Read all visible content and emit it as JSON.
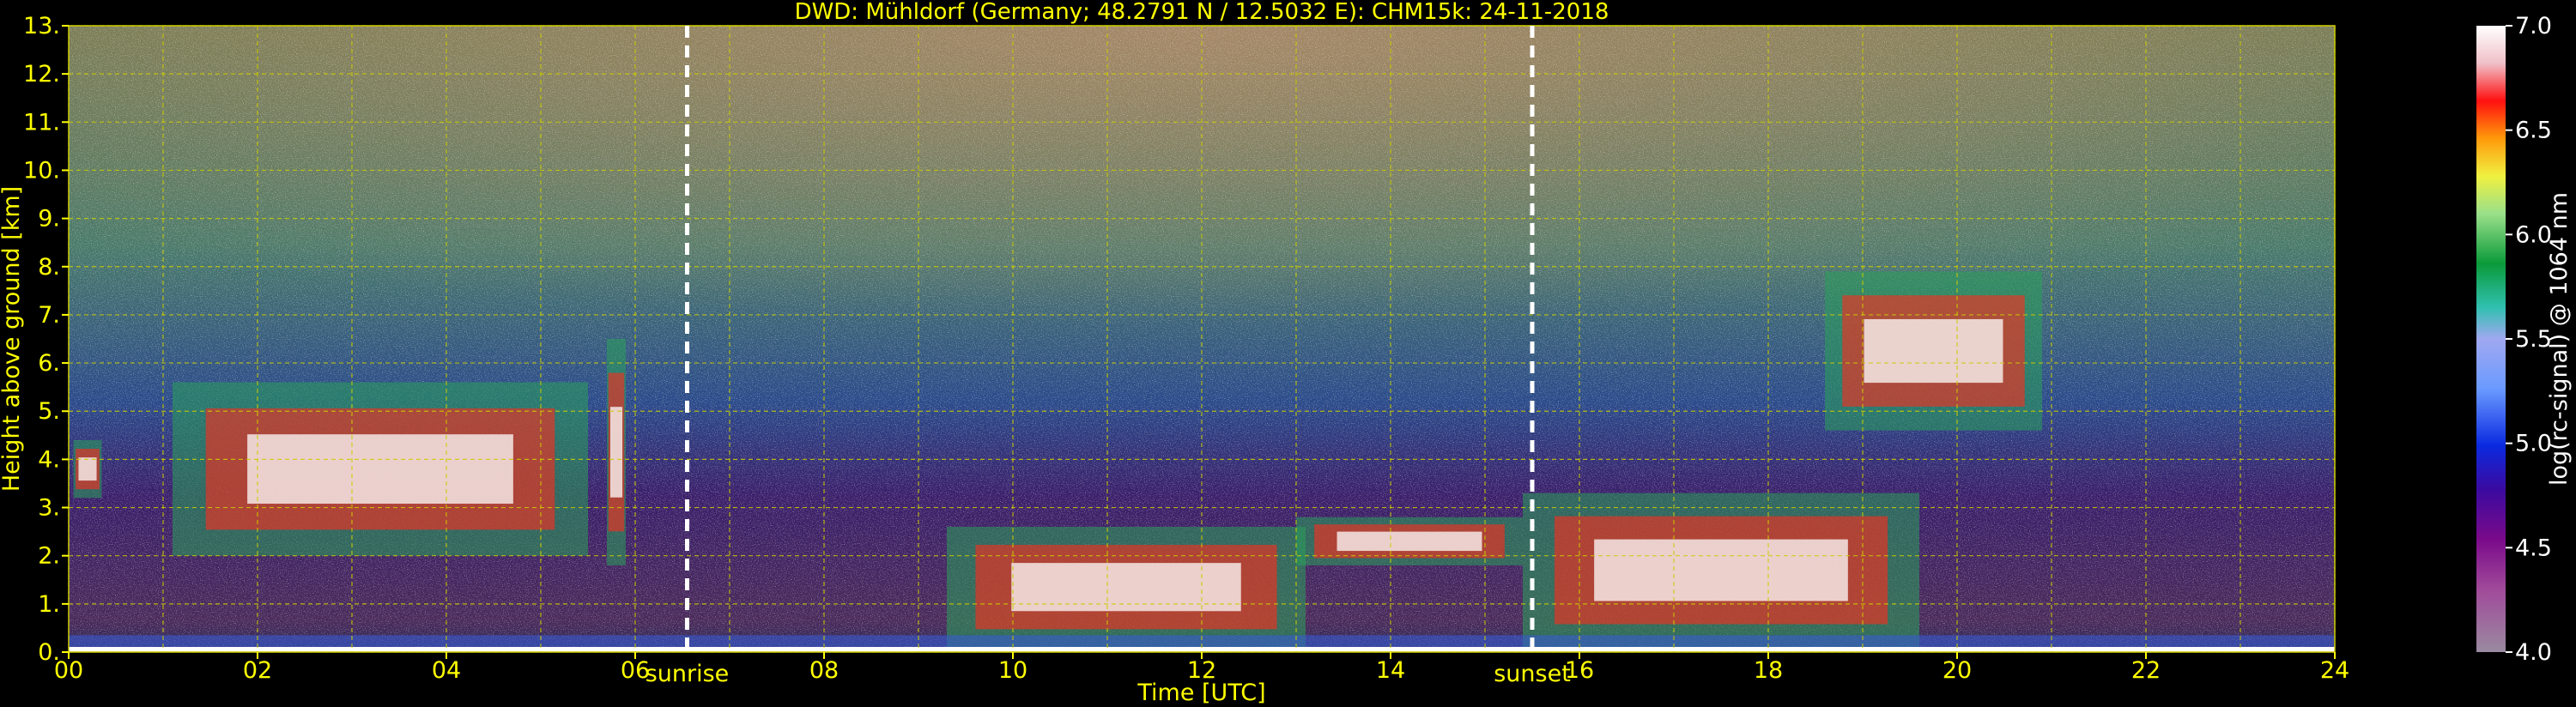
{
  "chart_data": {
    "type": "heatmap",
    "title": "DWD: Mühldorf (Germany; 48.2791 N / 12.5032 E):    CHM15k: 24-11-2018",
    "xlabel": "Time [UTC]",
    "ylabel": "Height above ground [km]",
    "xlim": [
      0,
      24
    ],
    "ylim": [
      0,
      13
    ],
    "x_ticks": [
      "00",
      "02",
      "04",
      "06",
      "08",
      "10",
      "12",
      "14",
      "16",
      "18",
      "20",
      "22",
      "24"
    ],
    "y_ticks": [
      "0.",
      "1.",
      "2.",
      "3.",
      "4.",
      "5.",
      "6.",
      "7.",
      "8.",
      "9.",
      "10.",
      "11.",
      "12.",
      "13."
    ],
    "grid": true,
    "markers": [
      {
        "label": "sunrise",
        "time": 6.55
      },
      {
        "label": "sunset",
        "time": 15.5
      }
    ],
    "colorbar": {
      "label": "log(rc-signal) @ 1064 nm",
      "range": [
        4.0,
        7.0
      ],
      "ticks": [
        "4.0",
        "4.5",
        "5.0",
        "5.5",
        "6.0",
        "6.5",
        "7.0"
      ]
    },
    "layers": [
      {
        "kind": "cloud",
        "t0": 0.05,
        "t1": 0.35,
        "h0": 3.2,
        "h1": 4.4
      },
      {
        "kind": "cloud",
        "t0": 1.1,
        "t1": 5.5,
        "h0": 2.0,
        "h1": 5.6
      },
      {
        "kind": "cloud",
        "t0": 5.7,
        "t1": 5.9,
        "h0": 1.8,
        "h1": 6.5
      },
      {
        "kind": "cloud",
        "t0": 9.3,
        "t1": 13.1,
        "h0": 0.1,
        "h1": 2.6
      },
      {
        "kind": "cloud",
        "t0": 13.0,
        "t1": 15.4,
        "h0": 1.8,
        "h1": 2.8
      },
      {
        "kind": "cloud",
        "t0": 15.4,
        "t1": 19.6,
        "h0": 0.1,
        "h1": 3.3
      },
      {
        "kind": "cloud",
        "t0": 18.6,
        "t1": 20.9,
        "h0": 4.6,
        "h1": 7.9
      },
      {
        "kind": "boundary-layer",
        "t0": 0.0,
        "t1": 24.0,
        "h0": 0.0,
        "h1": 0.35
      }
    ]
  }
}
